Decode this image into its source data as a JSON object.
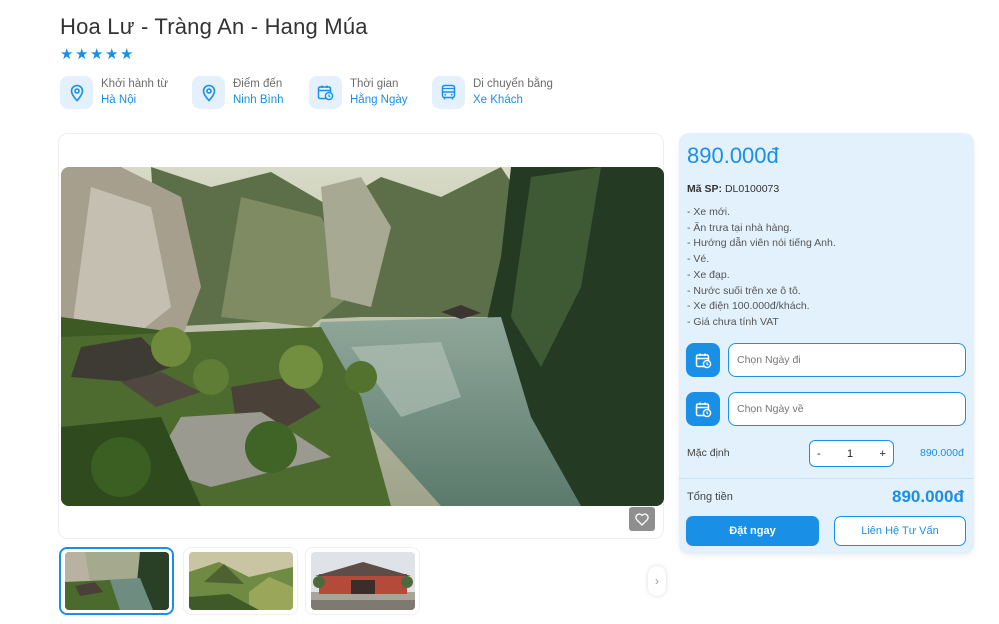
{
  "tour": {
    "title": "Hoa Lư - Tràng An - Hang Múa",
    "rating": 5
  },
  "info": [
    {
      "icon": "location-pin-icon",
      "label": "Khởi hành từ",
      "value": "Hà Nội"
    },
    {
      "icon": "location-pin-icon",
      "label": "Điểm đến",
      "value": "Ninh Bình"
    },
    {
      "icon": "calendar-clock-icon",
      "label": "Thời gian",
      "value": "Hằng Ngày"
    },
    {
      "icon": "bus-icon",
      "label": "Di chuyển bằng",
      "value": "Xe Khách"
    }
  ],
  "gallery": {
    "main_image": "landscape-photo-trang-an",
    "thumbnails": [
      "landscape-photo-trang-an",
      "landscape-photo-mua-cave",
      "photo-temple-gate"
    ],
    "active_thumbnail": 0,
    "favorite_icon": "heart-icon",
    "next_icon": "chevron-right-icon"
  },
  "booking": {
    "price": "890.000đ",
    "sku_label": "Mã SP:",
    "sku_value": "DL0100073",
    "includes": [
      "- Xe mới.",
      "- Ăn trưa tại nhà hàng.",
      "- Hướng dẫn viên nói tiếng Anh.",
      "- Vé.",
      "- Xe đạp.",
      "- Nước suối trên xe ô tô.",
      "- Xe điện 100.000đ/khách.",
      "- Giá chưa tính VAT"
    ],
    "depart_placeholder": "Chọn Ngày đi",
    "return_placeholder": "Chọn Ngày về",
    "qty_label": "Mặc định",
    "qty_minus": "-",
    "qty_value": "1",
    "qty_plus": "+",
    "line_price": "890.000đ",
    "total_label": "Tổng tiền",
    "total_value": "890.000đ",
    "book_label": "Đặt ngay",
    "contact_label": "Liên Hệ Tư Vấn"
  },
  "colors": {
    "accent": "#1a8fe6",
    "panel_bg": "#e2f1fc"
  }
}
